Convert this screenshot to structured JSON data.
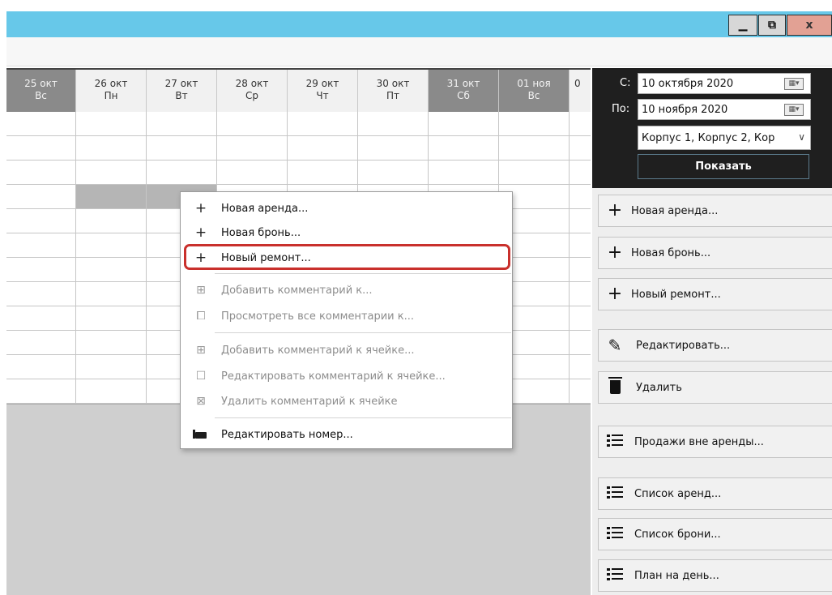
{
  "window": {
    "minimize_glyph": "▁",
    "maximize_glyph": "⧉",
    "close_glyph": "x"
  },
  "grid": {
    "dates": [
      {
        "day": "25 окт",
        "weekday": "Вс",
        "weekend": true
      },
      {
        "day": "26 окт",
        "weekday": "Пн",
        "weekend": false
      },
      {
        "day": "27 окт",
        "weekday": "Вт",
        "weekend": false
      },
      {
        "day": "28 окт",
        "weekday": "Ср",
        "weekend": false
      },
      {
        "day": "29 окт",
        "weekday": "Чт",
        "weekend": false
      },
      {
        "day": "30 окт",
        "weekday": "Пт",
        "weekend": false
      },
      {
        "day": "31 окт",
        "weekday": "Сб",
        "weekend": true
      },
      {
        "day": "01 ноя",
        "weekday": "Вс",
        "weekend": true
      }
    ],
    "partial_date": "0"
  },
  "context_menu": {
    "items": [
      {
        "label": "Новая аренда...",
        "icon": "plus-icon",
        "enabled": true
      },
      {
        "label": "Новая бронь...",
        "icon": "plus-icon",
        "enabled": true
      },
      {
        "label": "Новый ремонт...",
        "icon": "plus-icon",
        "enabled": true,
        "highlighted": true
      },
      {
        "label": "Добавить комментарий к...",
        "icon": "comment-add-icon",
        "enabled": false
      },
      {
        "label": "Просмотреть все комментарии к...",
        "icon": "comments-view-icon",
        "enabled": false
      },
      {
        "label": "Добавить комментарий к ячейке...",
        "icon": "comment-add-icon",
        "enabled": false
      },
      {
        "label": "Редактировать комментарий к ячейке...",
        "icon": "comment-edit-icon",
        "enabled": false
      },
      {
        "label": "Удалить комментарий к ячейке",
        "icon": "comment-delete-icon",
        "enabled": false
      },
      {
        "label": "Редактировать номер...",
        "icon": "bed-icon",
        "enabled": true
      }
    ]
  },
  "filter": {
    "from_label": "С:",
    "from_value": "10 октября  2020",
    "to_label": "По:",
    "to_value": "10  ноября  2020",
    "corpus_value": "Корпус 1, Корпус 2, Кор",
    "show_button": "Показать"
  },
  "actions": {
    "new_rent": "Новая аренда...",
    "new_booking": "Новая бронь...",
    "new_repair": "Новый ремонт...",
    "edit": "Редактировать...",
    "delete": "Удалить",
    "sales_outside_rent": "Продажи вне аренды...",
    "rent_list": "Список аренд...",
    "booking_list": "Список брони...",
    "day_plan": "План на день..."
  }
}
